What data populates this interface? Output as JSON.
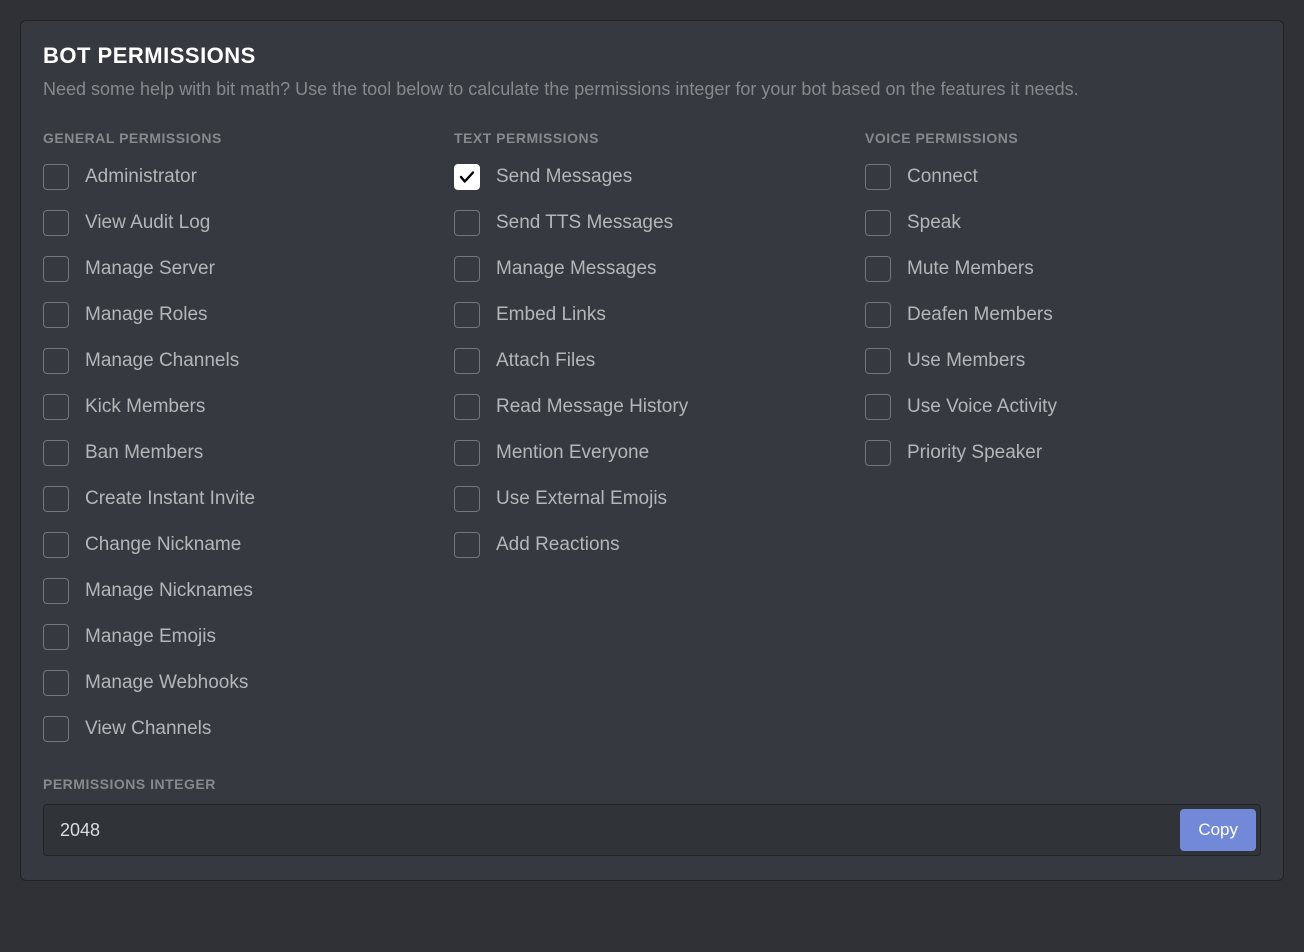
{
  "panel": {
    "title": "BOT PERMISSIONS",
    "description": "Need some help with bit math? Use the tool below to calculate the permissions integer for your bot based on the features it needs."
  },
  "columns": [
    {
      "header": "GENERAL PERMISSIONS",
      "items": [
        {
          "label": "Administrator",
          "checked": false
        },
        {
          "label": "View Audit Log",
          "checked": false
        },
        {
          "label": "Manage Server",
          "checked": false
        },
        {
          "label": "Manage Roles",
          "checked": false
        },
        {
          "label": "Manage Channels",
          "checked": false
        },
        {
          "label": "Kick Members",
          "checked": false
        },
        {
          "label": "Ban Members",
          "checked": false
        },
        {
          "label": "Create Instant Invite",
          "checked": false
        },
        {
          "label": "Change Nickname",
          "checked": false
        },
        {
          "label": "Manage Nicknames",
          "checked": false
        },
        {
          "label": "Manage Emojis",
          "checked": false
        },
        {
          "label": "Manage Webhooks",
          "checked": false
        },
        {
          "label": "View Channels",
          "checked": false
        }
      ]
    },
    {
      "header": "TEXT PERMISSIONS",
      "items": [
        {
          "label": "Send Messages",
          "checked": true
        },
        {
          "label": "Send TTS Messages",
          "checked": false
        },
        {
          "label": "Manage Messages",
          "checked": false
        },
        {
          "label": "Embed Links",
          "checked": false
        },
        {
          "label": "Attach Files",
          "checked": false
        },
        {
          "label": "Read Message History",
          "checked": false
        },
        {
          "label": "Mention Everyone",
          "checked": false
        },
        {
          "label": "Use External Emojis",
          "checked": false
        },
        {
          "label": "Add Reactions",
          "checked": false
        }
      ]
    },
    {
      "header": "VOICE PERMISSIONS",
      "items": [
        {
          "label": "Connect",
          "checked": false
        },
        {
          "label": "Speak",
          "checked": false
        },
        {
          "label": "Mute Members",
          "checked": false
        },
        {
          "label": "Deafen Members",
          "checked": false
        },
        {
          "label": "Use Members",
          "checked": false
        },
        {
          "label": "Use Voice Activity",
          "checked": false
        },
        {
          "label": "Priority Speaker",
          "checked": false
        }
      ]
    }
  ],
  "integer": {
    "label": "PERMISSIONS INTEGER",
    "value": "2048",
    "copy_label": "Copy"
  }
}
